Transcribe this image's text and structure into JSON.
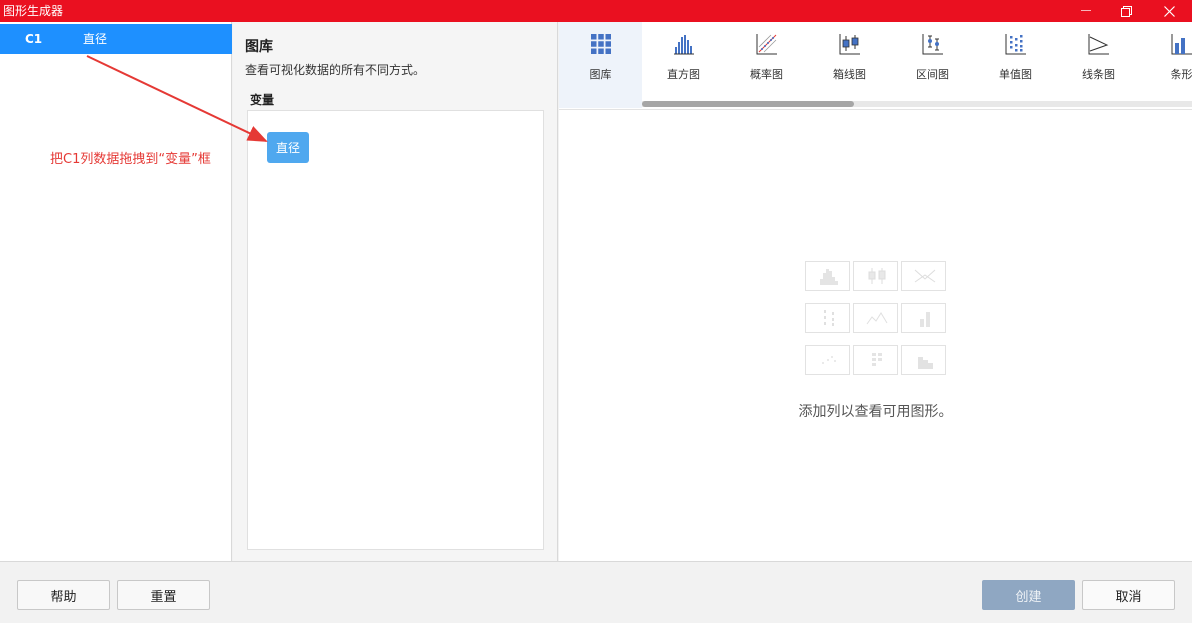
{
  "window": {
    "title": "图形生成器"
  },
  "columns": [
    {
      "id": "C1",
      "name": "直径"
    }
  ],
  "gallery": {
    "title": "图库",
    "subtitle": "查看可视化数据的所有不同方式。",
    "variable_label": "变量",
    "variable_chip": "直径"
  },
  "tabs": [
    {
      "label": "图库",
      "icon": "grid-icon",
      "active": true
    },
    {
      "label": "直方图",
      "icon": "histogram-icon",
      "active": false
    },
    {
      "label": "概率图",
      "icon": "probability-plot-icon",
      "active": false
    },
    {
      "label": "箱线图",
      "icon": "boxplot-icon",
      "active": false
    },
    {
      "label": "区间图",
      "icon": "interval-plot-icon",
      "active": false
    },
    {
      "label": "单值图",
      "icon": "individual-value-plot-icon",
      "active": false
    },
    {
      "label": "线条图",
      "icon": "line-plot-icon",
      "active": false
    },
    {
      "label": "条形",
      "icon": "bar-chart-icon",
      "active": false
    }
  ],
  "empty_state": {
    "message": "添加列以查看可用图形。"
  },
  "buttons": {
    "help": "帮助",
    "reset": "重置",
    "create": "创建",
    "cancel": "取消"
  },
  "annotation": {
    "text": "把C1列数据拖拽到“变量”框",
    "color": "#e53935"
  },
  "colors": {
    "titlebar": "#ea1020",
    "selection": "#1e90ff",
    "chip": "#4fa8ef",
    "create_disabled": "#8fa7c2"
  }
}
